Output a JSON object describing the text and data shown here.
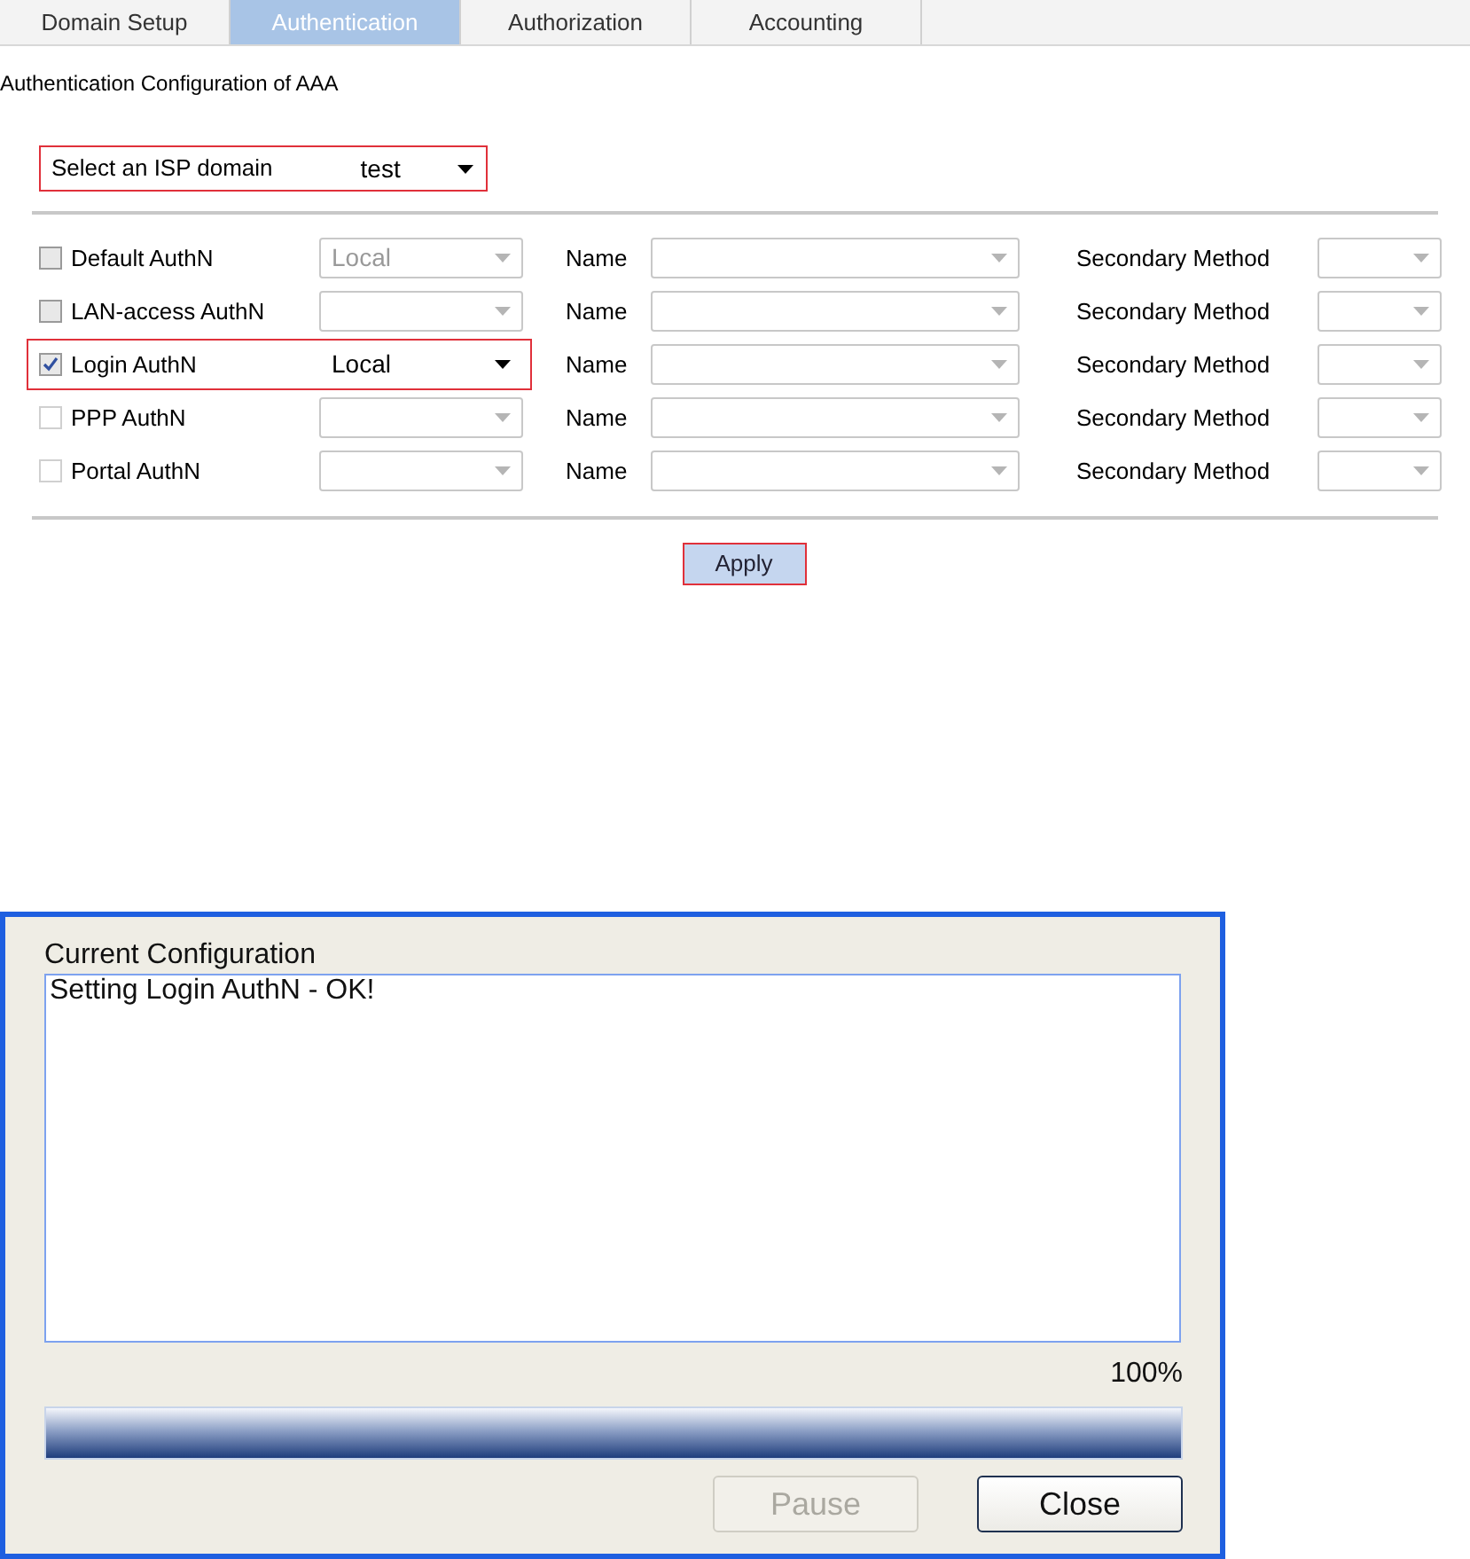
{
  "tabs": [
    {
      "label": "Domain Setup",
      "selected": false
    },
    {
      "label": "Authentication",
      "selected": true
    },
    {
      "label": "Authorization",
      "selected": false
    },
    {
      "label": "Accounting",
      "selected": false
    }
  ],
  "heading": "Authentication Configuration of AAA",
  "isp_domain": {
    "label": "Select an ISP domain",
    "value": "test",
    "highlighted": true
  },
  "methods": [
    {
      "label": "Default AuthN",
      "checked": false,
      "checkbox_disabled": false,
      "method": "Local",
      "method_disabled": true,
      "highlighted": false,
      "name_label": "Name",
      "secondary_label": "Secondary Method"
    },
    {
      "label": "LAN-access AuthN",
      "checked": false,
      "checkbox_disabled": false,
      "method_disabled": true,
      "highlighted": false,
      "name_label": "Name",
      "secondary_label": "Secondary Method"
    },
    {
      "label": "Login AuthN",
      "checked": true,
      "checkbox_disabled": false,
      "method": "Local",
      "method_disabled": false,
      "highlighted": true,
      "name_label": "Name",
      "secondary_label": "Secondary Method"
    },
    {
      "label": "PPP AuthN",
      "checked": false,
      "checkbox_disabled": true,
      "method_disabled": true,
      "highlighted": false,
      "name_label": "Name",
      "secondary_label": "Secondary Method"
    },
    {
      "label": "Portal AuthN",
      "checked": false,
      "checkbox_disabled": true,
      "method_disabled": true,
      "highlighted": false,
      "name_label": "Name",
      "secondary_label": "Secondary Method"
    }
  ],
  "apply_button": {
    "label": "Apply",
    "highlighted": true
  },
  "dialog": {
    "title": "Current Configuration",
    "log": "Setting Login AuthN - OK!",
    "percent": "100%",
    "level": 1,
    "buttons": [
      {
        "label": "Pause",
        "disabled": true
      },
      {
        "label": "Close",
        "disabled": false
      }
    ]
  }
}
